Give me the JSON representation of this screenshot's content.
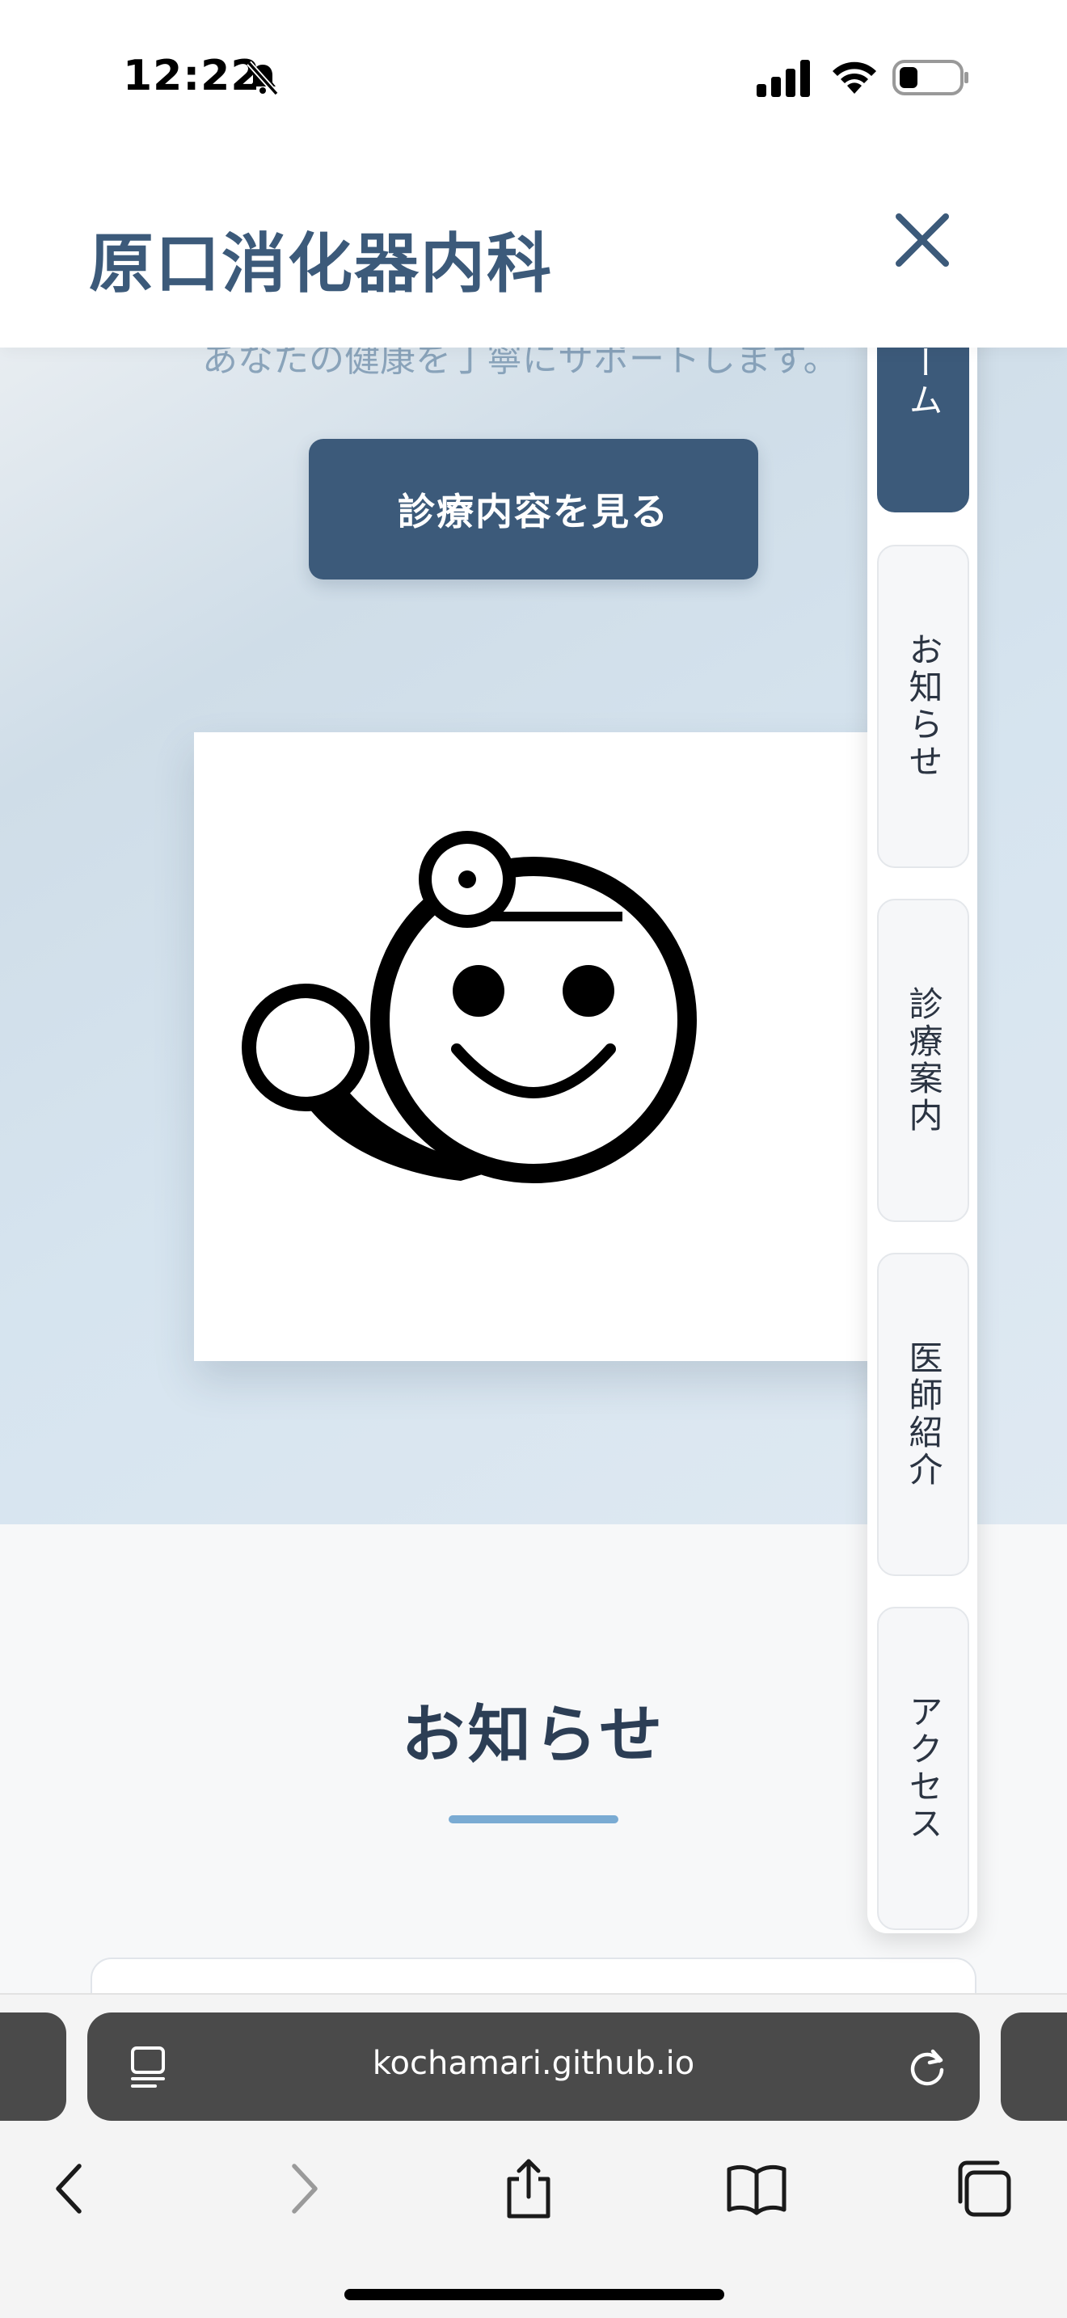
{
  "status_bar": {
    "time": "12:22"
  },
  "header": {
    "site_title": "原口消化器内科"
  },
  "hero": {
    "tagline": "あなたの健康を丁寧にサポートします。",
    "cta_label": "診療内容を見る"
  },
  "news": {
    "heading": "お知らせ"
  },
  "nav": {
    "items": [
      {
        "label": "ホーム",
        "active": true
      },
      {
        "label": "お知らせ",
        "active": false
      },
      {
        "label": "診療案内",
        "active": false
      },
      {
        "label": "医師紹介",
        "active": false
      },
      {
        "label": "アクセス",
        "active": false
      }
    ]
  },
  "browser": {
    "url": "kochamari.github.io"
  },
  "colors": {
    "brand": "#3c5a7a",
    "accent_underline": "#7aabd3",
    "nav_active_text": "#ffffff"
  }
}
